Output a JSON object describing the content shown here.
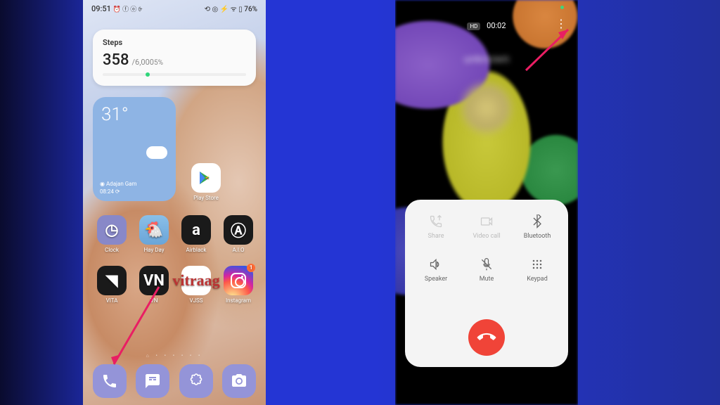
{
  "left": {
    "status": {
      "time": "09:51",
      "icons_l": "⏰ ⓕ ⓞ ⨭",
      "right": "⟲ ◎ ⚡ ᯤ ▯ 76%"
    },
    "steps": {
      "title": "Steps",
      "value": "358",
      "goal": "/6,000",
      "percent": "5%"
    },
    "weather": {
      "temp": "31°",
      "location": "◉ Adajan Gam",
      "time": "08:24 ⟳"
    },
    "apps": {
      "playstore": "Play Store",
      "clock": "Clock",
      "hayday": "Hay Day",
      "airblack": "Airblack",
      "aio": "A.I.O",
      "vita": "VITA",
      "vn": "VN",
      "vjss": "VJSS",
      "instagram": "Instagram",
      "insta_badge": "1"
    }
  },
  "right": {
    "hd": "HD",
    "duration": "00:02",
    "caller": "unknown",
    "controls": {
      "share": "Share",
      "video": "Video call",
      "bluetooth": "Bluetooth",
      "speaker": "Speaker",
      "mute": "Mute",
      "keypad": "Keypad"
    }
  }
}
